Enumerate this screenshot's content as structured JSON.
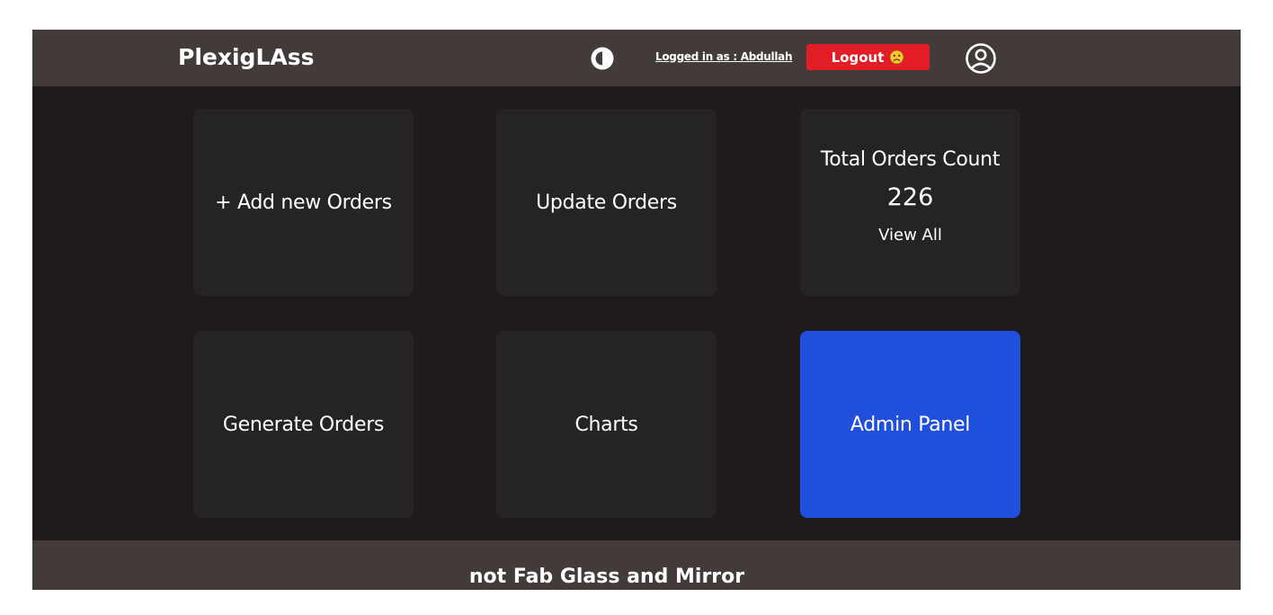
{
  "header": {
    "brand": "PlexigLAss",
    "logged_in_text": "Logged in as : Abdullah",
    "logout_label": "Logout",
    "theme_toggle_icon": "half-circle-contrast-icon",
    "logout_icon": "sad-face-icon",
    "avatar_icon": "user-circle-icon"
  },
  "cards": {
    "add_orders": "+ Add new Orders",
    "update_orders": "Update Orders",
    "total_orders": {
      "title": "Total Orders Count",
      "count": "226",
      "link": "View All"
    },
    "generate_orders": "Generate Orders",
    "charts": "Charts",
    "admin_panel": "Admin Panel"
  },
  "footer": {
    "text": "not Fab Glass and Mirror"
  },
  "colors": {
    "background": "#1f1b1a",
    "header_bg": "#433a3a",
    "card_bg": "#252324",
    "accent_blue": "#1f4fdb",
    "logout_red": "#e21d25"
  }
}
